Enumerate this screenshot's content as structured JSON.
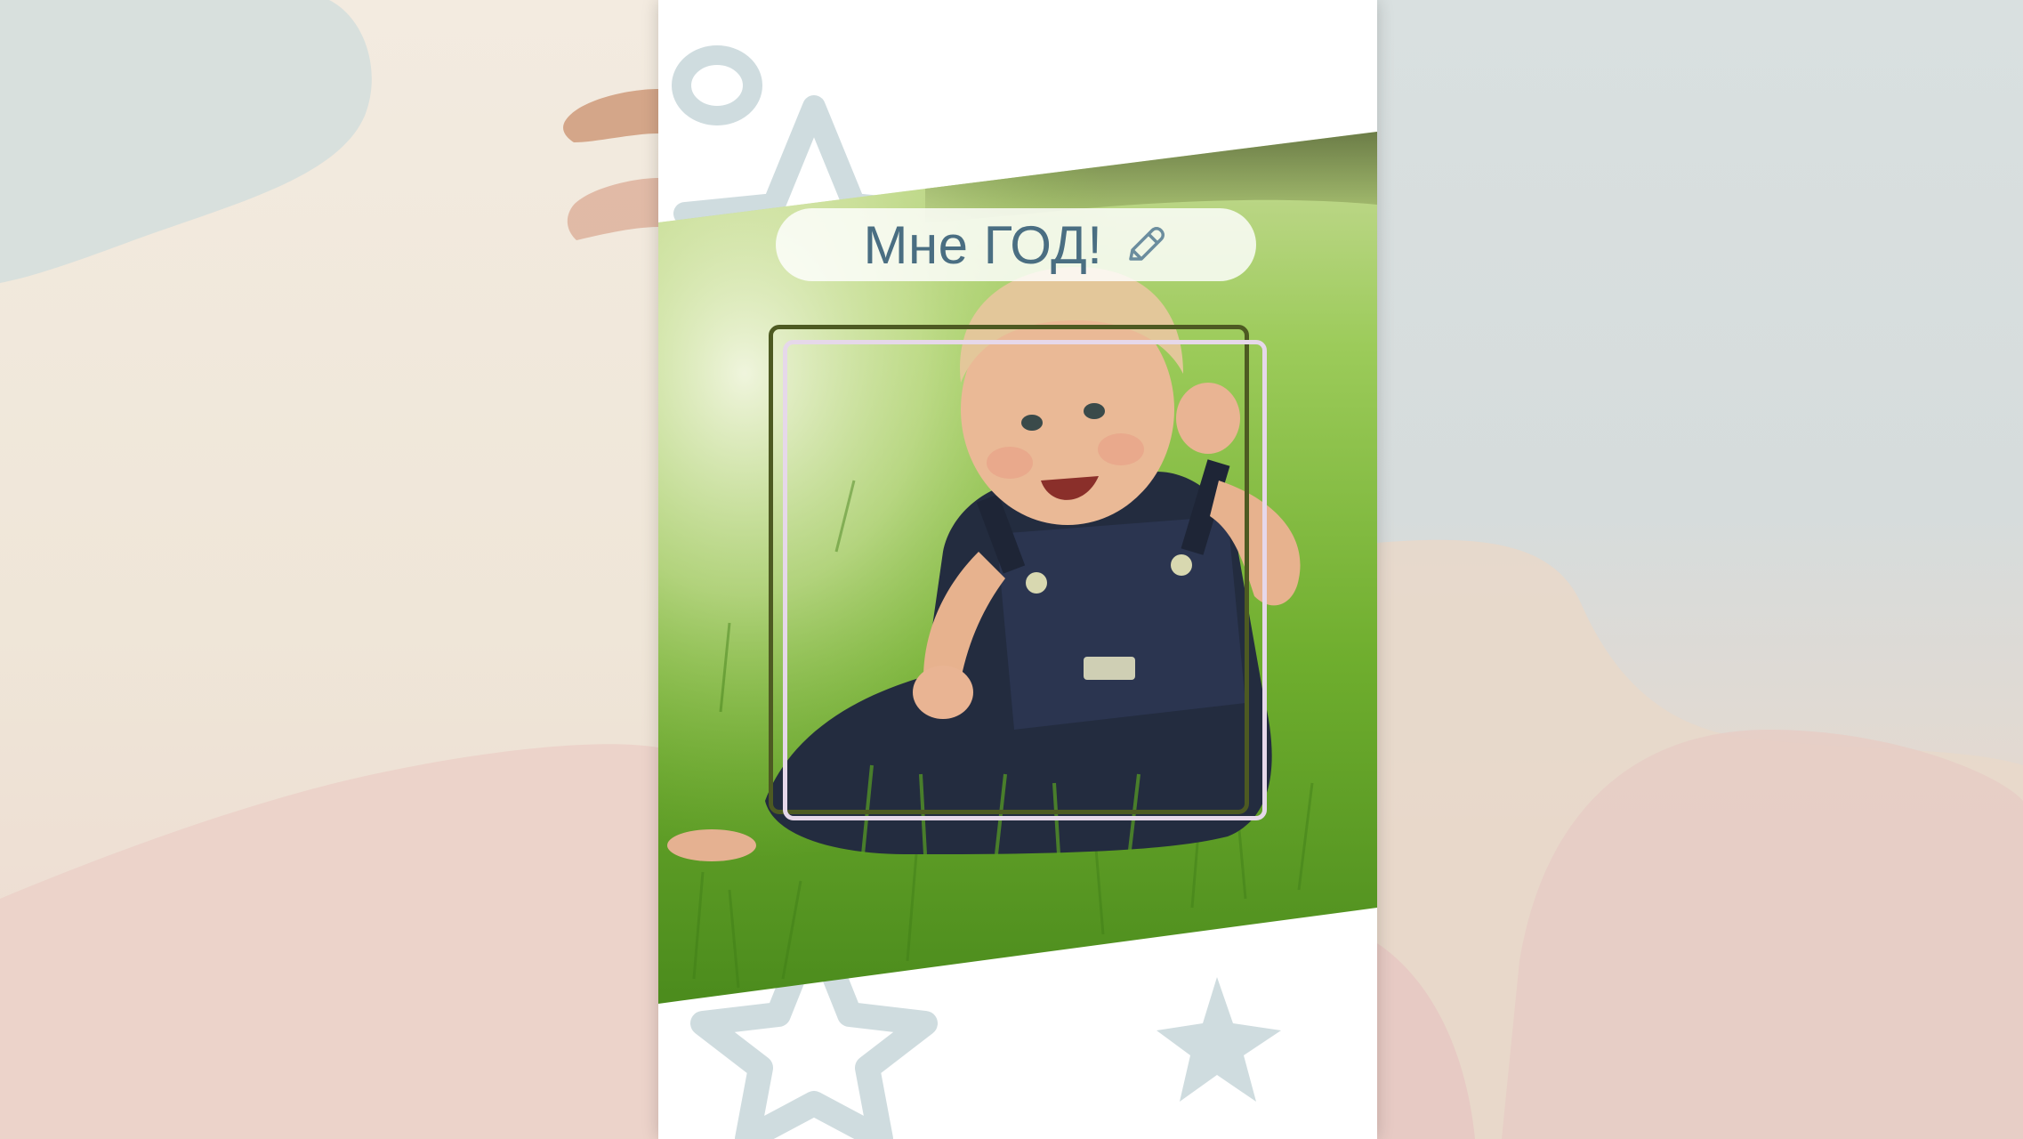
{
  "card": {
    "title": "Мне ГОД!"
  },
  "icons": {
    "edit": "pencil-icon"
  },
  "colors": {
    "title_text": "#4a6e82",
    "card_background": "#ffffff",
    "decor_shapes": "#cfdcdf",
    "frame_outer": "#4d5a22",
    "frame_inner": "#e6d8ea",
    "left_background": "#f0e8dc",
    "right_background": "#d7dede",
    "pink_wash": "#ead2ca"
  }
}
